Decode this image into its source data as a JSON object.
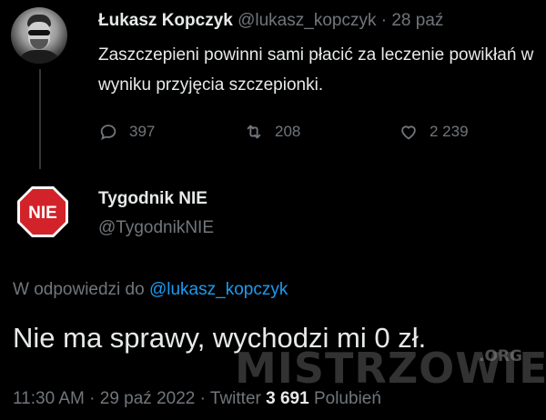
{
  "tweet": {
    "author_name": "Łukasz Kopczyk",
    "author_handle": "@lukasz_kopczyk",
    "separator": "·",
    "date": "28 paź",
    "text": "Zaszczepieni powinni sami płacić za leczenie powikłań w wyniku przyjęcia szczepionki.",
    "replies": "397",
    "retweets": "208",
    "likes": "2 239"
  },
  "reply": {
    "author_name": "Tygodnik NIE",
    "author_handle": "@TygodnikNIE",
    "avatar_text": "NIE",
    "reply_to_prefix": "W odpowiedzi do",
    "reply_to_handle": "@lukasz_kopczyk",
    "text": "Nie ma sprawy, wychodzi mi 0 zł.",
    "time": "11:30 AM",
    "sep1": "·",
    "date": "29 paź 2022",
    "sep2": "·",
    "source": "Twitter",
    "like_count": "3 691",
    "like_label": "Polubień"
  },
  "watermark": {
    "text": "MISTRZOWIE",
    "suffix": ".ORG"
  },
  "colors": {
    "background": "#000000",
    "primary_text": "#e7e9ea",
    "secondary_text": "#71767b",
    "link": "#1d9bf0",
    "stop_sign_red": "#d2232a"
  },
  "icons": {
    "reply": "speech-bubble-icon",
    "retweet": "retweet-icon",
    "like": "heart-icon"
  }
}
